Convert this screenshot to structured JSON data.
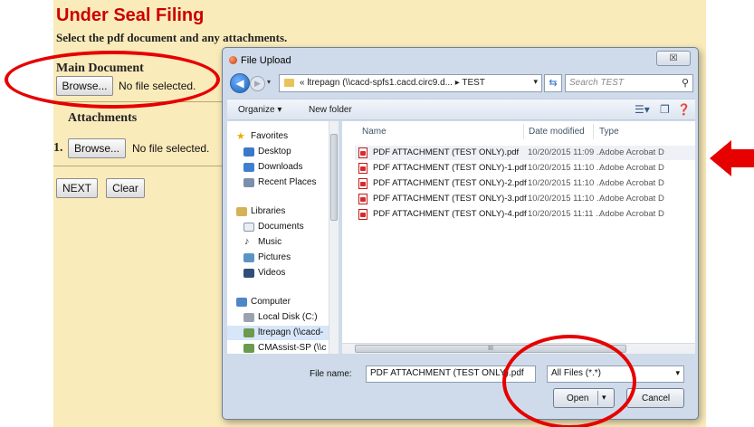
{
  "page": {
    "title": "Under Seal Filing",
    "subtitle": "Select the pdf document and any attachments.",
    "main_label": "Main Document",
    "browse_label": "Browse...",
    "no_file_text": "No file selected.",
    "attachments_label": "Attachments",
    "attachment_number": "1.",
    "next_label": "NEXT",
    "clear_label": "Clear"
  },
  "dialog": {
    "title": "File Upload",
    "close_glyph": "☒",
    "breadcrumb": "« ltrepagn (\\\\cacd-spfs1.cacd.circ9.d... ▸ TEST",
    "search_placeholder": "Search TEST",
    "toolbar": {
      "organize": "Organize ▾",
      "new_folder": "New folder"
    },
    "nav": {
      "favorites": "Favorites",
      "desktop": "Desktop",
      "downloads": "Downloads",
      "recent": "Recent Places",
      "libraries": "Libraries",
      "documents": "Documents",
      "music": "Music",
      "pictures": "Pictures",
      "videos": "Videos",
      "computer": "Computer",
      "local_disk": "Local Disk (C:)",
      "share1": "ltrepagn (\\\\cacd-",
      "share2": "CMAssist-SP (\\\\c"
    },
    "columns": {
      "name": "Name",
      "date": "Date modified",
      "type": "Type"
    },
    "files": [
      {
        "name": "PDF ATTACHMENT (TEST ONLY).pdf",
        "date": "10/20/2015 11:09 ...",
        "type": "Adobe Acrobat D"
      },
      {
        "name": "PDF ATTACHMENT (TEST ONLY)-1.pdf",
        "date": "10/20/2015 11:10 ...",
        "type": "Adobe Acrobat D"
      },
      {
        "name": "PDF ATTACHMENT (TEST ONLY)-2.pdf",
        "date": "10/20/2015 11:10 ...",
        "type": "Adobe Acrobat D"
      },
      {
        "name": "PDF ATTACHMENT (TEST ONLY)-3.pdf",
        "date": "10/20/2015 11:10 ...",
        "type": "Adobe Acrobat D"
      },
      {
        "name": "PDF ATTACHMENT (TEST ONLY)-4.pdf",
        "date": "10/20/2015 11:11 ...",
        "type": "Adobe Acrobat D"
      }
    ],
    "file_name_label": "File name:",
    "file_name_value": "PDF ATTACHMENT (TEST ONLY).pdf",
    "file_type_value": "All Files (*.*)",
    "open_label": "Open",
    "cancel_label": "Cancel",
    "scroll_grip": "III"
  },
  "colors": {
    "page_background": "#faebbb",
    "title_red": "#cc0000",
    "annotation_red": "#e60000",
    "dialog_frame": "#cfdbea"
  }
}
